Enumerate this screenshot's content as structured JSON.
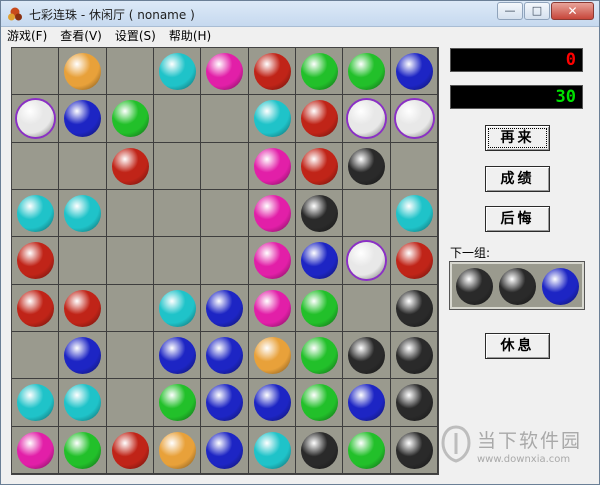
{
  "window": {
    "title": "七彩连珠 - 休闲厅 ( noname )",
    "minimize_glyph": "—",
    "maximize_glyph": "□",
    "close_glyph": "✕"
  },
  "menu": [
    {
      "label": "游戏(F)"
    },
    {
      "label": "查看(V)"
    },
    {
      "label": "设置(S)"
    },
    {
      "label": "帮助(H)"
    }
  ],
  "colors": {
    "orange": "#e8a13a",
    "cyan": "#1fc3c9",
    "magenta": "#e21fa8",
    "red": "#c02418",
    "green": "#22c02a",
    "blue": "#1d25c4",
    "black": "#2a2a2a",
    "white": "#e8e8e8",
    "board": "#9a9a8e"
  },
  "board": {
    "rows": 9,
    "cols": 9,
    "grid": [
      [
        "",
        "orange",
        "",
        "cyan",
        "magenta",
        "red",
        "green",
        "green",
        "blue"
      ],
      [
        "white*",
        "blue",
        "green",
        "",
        "",
        "cyan",
        "red",
        "white*",
        "white*"
      ],
      [
        "",
        "",
        "red",
        "",
        "",
        "magenta",
        "red",
        "black",
        ""
      ],
      [
        "cyan",
        "cyan",
        "",
        "",
        "",
        "magenta",
        "black",
        "",
        "cyan"
      ],
      [
        "red",
        "",
        "",
        "",
        "",
        "magenta",
        "blue",
        "white*",
        "red"
      ],
      [
        "red",
        "red",
        "",
        "cyan",
        "blue",
        "magenta",
        "green",
        "",
        "black"
      ],
      [
        "",
        "blue",
        "",
        "blue",
        "blue",
        "orange",
        "green",
        "black",
        "black"
      ],
      [
        "cyan",
        "cyan",
        "",
        "green",
        "blue",
        "blue",
        "green",
        "blue",
        "black"
      ],
      [
        "magenta",
        "green",
        "red",
        "orange",
        "blue",
        "cyan",
        "black",
        "green",
        "black"
      ]
    ]
  },
  "scores": {
    "top": "0",
    "bottom": "30"
  },
  "buttons": {
    "new_game": "再来",
    "scores": "成绩",
    "undo": "后悔",
    "pause": "休息"
  },
  "next_group": {
    "label": "下一组:",
    "balls": [
      "black",
      "black",
      "blue"
    ]
  },
  "watermark": {
    "text": "当下软件园",
    "url": "www.downxia.com"
  }
}
